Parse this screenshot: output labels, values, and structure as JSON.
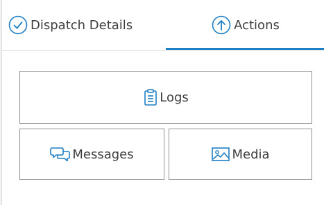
{
  "colors": {
    "accent": "#1e7fc4",
    "border": "#8f8f8f",
    "text": "#3d3d3d"
  },
  "tabs": [
    {
      "label": "Dispatch Details",
      "icon": "check-circle-icon",
      "active": false
    },
    {
      "label": "Actions",
      "icon": "arrow-up-circle-icon",
      "active": true
    }
  ],
  "actions": {
    "logs_label": "Logs",
    "logs_icon": "clipboard-icon",
    "messages_label": "Messages",
    "messages_icon": "chat-bubbles-icon",
    "media_label": "Media",
    "media_icon": "image-icon"
  }
}
